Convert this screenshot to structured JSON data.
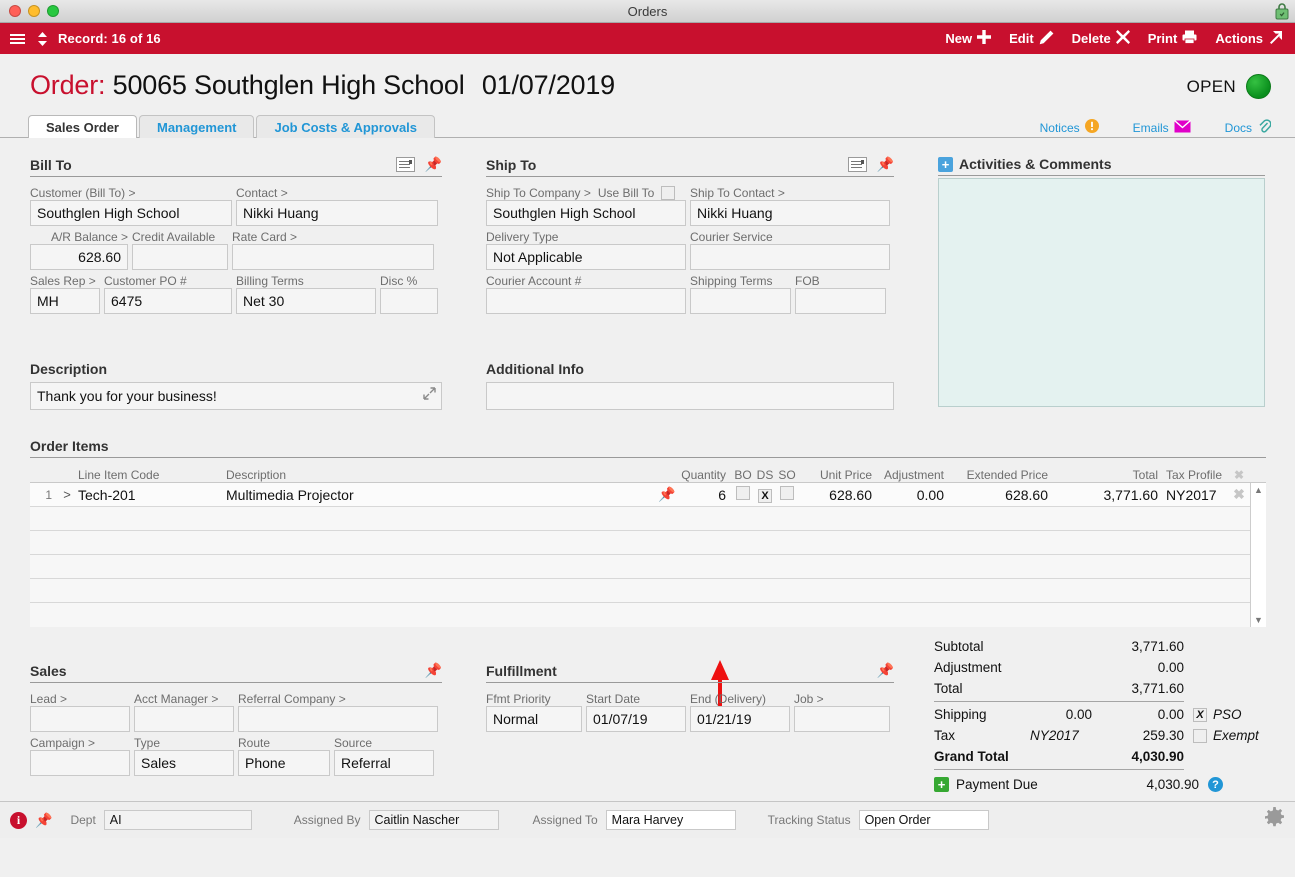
{
  "window": {
    "title": "Orders",
    "lock_icon": "lock-icon"
  },
  "toolbar": {
    "menu_icon": "hamburger-icon",
    "nav_icon": "up-down-arrows-icon",
    "record_label": "Record: 16 of 16",
    "buttons": [
      {
        "label": "New",
        "icon": "plus-icon"
      },
      {
        "label": "Edit",
        "icon": "pencil-icon"
      },
      {
        "label": "Delete",
        "icon": "x-cross-icon"
      },
      {
        "label": "Print",
        "icon": "printer-icon"
      },
      {
        "label": "Actions",
        "icon": "arrow-up-right-icon"
      }
    ],
    "accent_color": "#c8102e"
  },
  "header": {
    "label": "Order:",
    "order_number": "50065",
    "customer": "Southglen High School",
    "date": "01/07/2019",
    "status_text": "OPEN",
    "status_color": "#1a9b2a"
  },
  "tabs": [
    {
      "label": "Sales Order",
      "active": true
    },
    {
      "label": "Management",
      "active": false
    },
    {
      "label": "Job Costs & Approvals",
      "active": false
    }
  ],
  "tab_links": [
    {
      "label": "Notices",
      "icon": "warning-circle-icon",
      "color": "#f5a623"
    },
    {
      "label": "Emails",
      "icon": "envelope-icon",
      "color": "#e000c8"
    },
    {
      "label": "Docs",
      "icon": "paperclip-icon",
      "color": "#3aa8a0"
    }
  ],
  "bill_to": {
    "title": "Bill To",
    "note_icon": "note-icon",
    "pin_icon": "pin-icon",
    "fields": {
      "customer_label": "Customer (Bill To) >",
      "customer_value": "Southglen High School",
      "contact_label": "Contact >",
      "contact_value": "Nikki Huang",
      "ar_balance_label": "A/R Balance >",
      "ar_balance_value": "628.60",
      "credit_available_label": "Credit Available",
      "credit_available_value": "",
      "rate_card_label": "Rate Card >",
      "rate_card_value": "",
      "sales_rep_label": "Sales Rep >",
      "sales_rep_value": "MH",
      "customer_po_label": "Customer PO #",
      "customer_po_value": "6475",
      "billing_terms_label": "Billing Terms",
      "billing_terms_value": "Net 30",
      "disc_label": "Disc %",
      "disc_value": ""
    }
  },
  "ship_to": {
    "title": "Ship To",
    "note_icon": "note-icon",
    "pin_icon": "pin-icon",
    "fields": {
      "company_label": "Ship To Company >",
      "company_value": "Southglen High School",
      "use_bill_to_label": "Use Bill To",
      "use_bill_to_checked": false,
      "contact_label": "Ship To Contact >",
      "contact_value": "Nikki Huang",
      "delivery_type_label": "Delivery Type",
      "delivery_type_value": "Not Applicable",
      "courier_service_label": "Courier Service",
      "courier_service_value": "",
      "courier_account_label": "Courier Account #",
      "courier_account_value": "",
      "shipping_terms_label": "Shipping Terms",
      "shipping_terms_value": "",
      "fob_label": "FOB",
      "fob_value": ""
    }
  },
  "activities": {
    "title": "Activities & Comments",
    "add_icon": "plus-square-icon",
    "content": ""
  },
  "description": {
    "title": "Description",
    "value": "Thank you for your business!",
    "expand_icon": "expand-arrows-icon"
  },
  "additional_info": {
    "title": "Additional Info",
    "value": ""
  },
  "order_items": {
    "title": "Order Items",
    "columns": [
      "Line Item Code",
      "Description",
      "Quantity",
      "BO",
      "DS",
      "SO",
      "Unit Price",
      "Adjustment",
      "Extended Price",
      "Total",
      "Tax Profile"
    ],
    "delete_col_icon": "x-delete-icon",
    "rows": [
      {
        "num": "1",
        "expand": ">",
        "code": "Tech-201",
        "description": "Multimedia Projector",
        "pin_icon": "pin-icon",
        "quantity": "6",
        "bo": false,
        "ds": true,
        "so": false,
        "unit_price": "628.60",
        "adjustment": "0.00",
        "extended_price": "628.60",
        "total": "3,771.60",
        "tax_profile": "NY2017"
      }
    ],
    "empty_row_count": 5,
    "scroll_up_icon": "chevron-up-icon",
    "scroll_down_icon": "chevron-down-icon"
  },
  "annotation": {
    "type": "red-arrow",
    "points_to": "ds-checkbox",
    "color": "#ee1111"
  },
  "totals": {
    "rows": [
      {
        "label": "Subtotal",
        "mid": "",
        "value": "3,771.60",
        "bold": false
      },
      {
        "label": "Adjustment",
        "mid": "",
        "value": "0.00",
        "bold": false
      },
      {
        "label": "Total",
        "mid": "",
        "value": "3,771.60",
        "bold": false
      }
    ],
    "shipping": {
      "label": "Shipping",
      "mid": "0.00",
      "value": "0.00",
      "checkbox_checked": true,
      "checkbox_mark": "X",
      "extra": "PSO"
    },
    "tax": {
      "label": "Tax",
      "profile": "NY2017",
      "value": "259.30",
      "checkbox_checked": false,
      "extra": "Exempt"
    },
    "grand_total": {
      "label": "Grand Total",
      "value": "4,030.90"
    },
    "payment_due": {
      "label": "Payment Due",
      "value": "4,030.90",
      "add_icon": "plus-square-icon",
      "help_icon": "question-circle-icon"
    }
  },
  "sales": {
    "title": "Sales",
    "pin_icon": "pin-icon",
    "fields": {
      "lead_label": "Lead >",
      "lead_value": "",
      "acct_manager_label": "Acct Manager >",
      "acct_manager_value": "",
      "referral_company_label": "Referral Company >",
      "referral_company_value": "",
      "campaign_label": "Campaign >",
      "campaign_value": "",
      "type_label": "Type",
      "type_value": "Sales",
      "route_label": "Route",
      "route_value": "Phone",
      "source_label": "Source",
      "source_value": "Referral"
    }
  },
  "fulfillment": {
    "title": "Fulfillment",
    "pin_icon": "pin-icon",
    "fields": {
      "priority_label": "Ffmt Priority",
      "priority_value": "Normal",
      "start_date_label": "Start Date",
      "start_date_value": "01/07/19",
      "end_date_label": "End (Delivery)",
      "end_date_value": "01/21/19",
      "job_label": "Job >",
      "job_value": ""
    }
  },
  "footer": {
    "info_icon": "info-icon",
    "pin_icon": "pin-icon",
    "dept_label": "Dept",
    "dept_value": "AI",
    "assigned_by_label": "Assigned By",
    "assigned_by_value": "Caitlin Nascher",
    "assigned_to_label": "Assigned To",
    "assigned_to_value": "Mara Harvey",
    "tracking_status_label": "Tracking Status",
    "tracking_status_value": "Open Order",
    "gear_icon": "gear-icon"
  }
}
